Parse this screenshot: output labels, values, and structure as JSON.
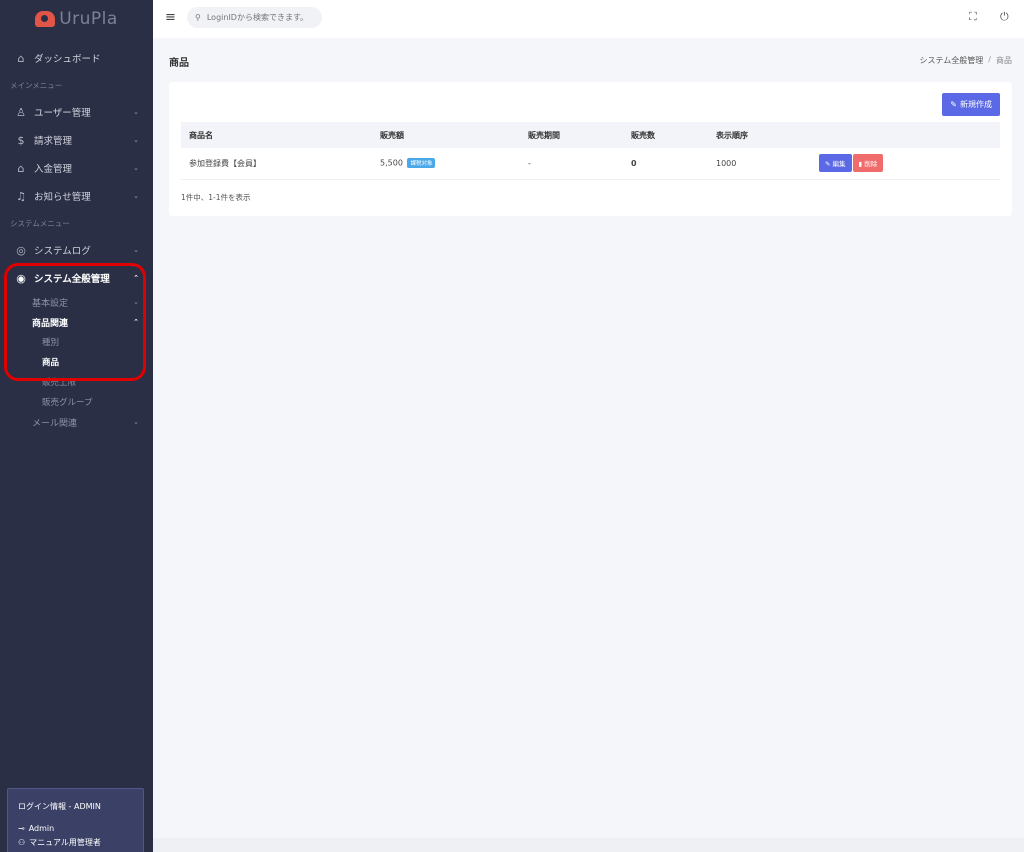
{
  "app": {
    "logo_text": "UruPla"
  },
  "topbar": {
    "search_placeholder": "LoginIDから検索できます。",
    "fullscreen_icon": "fullscreen-icon",
    "power_icon": "power-icon"
  },
  "sidebar": {
    "dashboard": "ダッシュボード",
    "section_main": "メインメニュー",
    "user_mgmt": "ユーザー管理",
    "billing_mgmt": "請求管理",
    "payment_mgmt": "入金管理",
    "notice_mgmt": "お知らせ管理",
    "section_system": "システムメニュー",
    "system_log": "システムログ",
    "system_general": "システム全般管理",
    "basic_settings": "基本設定",
    "product_related": "商品関連",
    "category": "種別",
    "product": "商品",
    "sales_limit": "販売上限",
    "sales_group": "販売グループ",
    "mail_related": "メール関連"
  },
  "login": {
    "title": "ログイン情報 - ADMIN",
    "user": "Admin",
    "role": "マニュアル用管理者"
  },
  "page": {
    "title": "商品",
    "breadcrumb_parent": "システム全般管理",
    "breadcrumb_sep": "/",
    "breadcrumb_current": "商品",
    "new_button": "新規作成"
  },
  "table": {
    "headers": [
      "商品名",
      "販売額",
      "販売期間",
      "販売数",
      "表示順序"
    ],
    "rows": [
      {
        "name": "参加登録費【会員】",
        "price": "5,500",
        "tax_badge": "課税対象",
        "period": "-",
        "sold": "0",
        "order": "1000",
        "edit_label": "編集",
        "delete_label": "削除"
      }
    ],
    "count_text": "1件中、1-1件を表示"
  }
}
